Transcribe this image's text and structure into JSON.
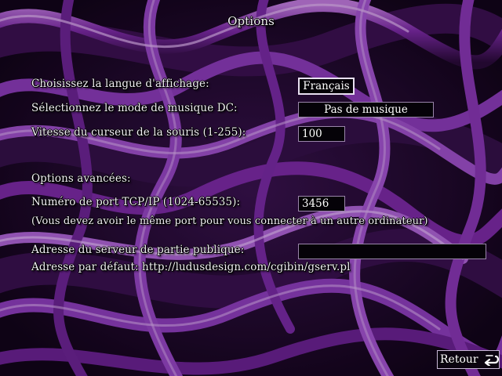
{
  "title": "Options",
  "language": {
    "label": "Choisissez la langue d'affichage:",
    "value": "Français"
  },
  "music": {
    "label": "Sélectionnez le mode de musique DC:",
    "value": "Pas de musique"
  },
  "mouse_speed": {
    "label": "Vitesse du curseur de la souris (1-255):",
    "value": "100"
  },
  "advanced": {
    "heading": "Options avancées:"
  },
  "port": {
    "label": "Numéro de port TCP/IP (1024-65535):",
    "value": "3456",
    "note": "(Vous devez avoir le même port pour vous connecter à un autre ordinateur)"
  },
  "server": {
    "label": "Adresse du serveur de partie publique:",
    "value": "",
    "default_text": "Adresse par défaut: http://ludusdesign.com/cgibin/gserv.pl"
  },
  "back_button": {
    "label": "Retour",
    "icon": "return-arrow-icon"
  },
  "colors": {
    "background": "#1a0724",
    "accent": "#8a2fb4",
    "field_bg": "#050208"
  }
}
